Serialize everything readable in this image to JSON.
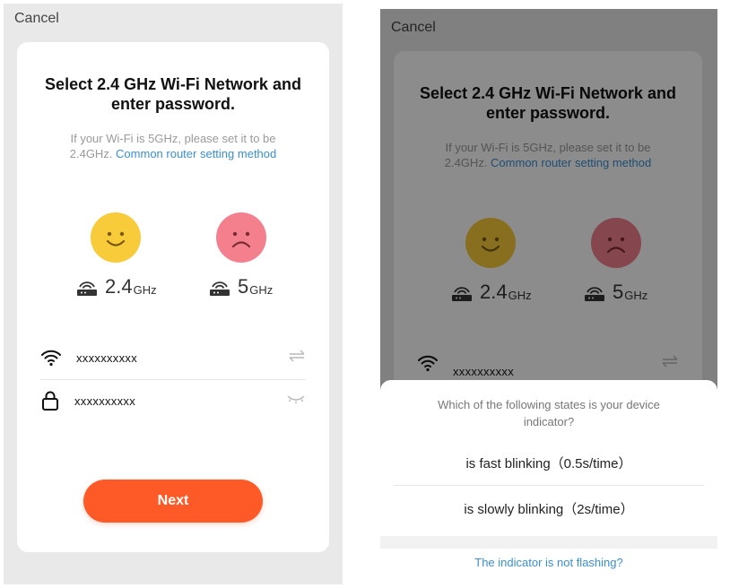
{
  "left_screen": {
    "cancel": "Cancel",
    "title_line1": "Select 2.4 GHz Wi-Fi Network and",
    "title_line2": "enter password.",
    "sub_line1": "If your Wi-Fi is 5GHz, please set it to be",
    "sub_line2_prefix": "2.4GHz. ",
    "sub_link": "Common router setting method",
    "band_24_value": "2.4",
    "band_24_unit": "GHz",
    "band_5_value": "5",
    "band_5_unit": "GHz",
    "wifi_value": "xxxxxxxxxx",
    "password_value": "xxxxxxxxxx",
    "next_label": "Next"
  },
  "right_screen": {
    "cancel": "Cancel",
    "title_line1": "Select 2.4 GHz Wi-Fi Network and",
    "title_line2": "enter password.",
    "sub_line1": "If your Wi-Fi is 5GHz, please set it to be",
    "sub_line2_prefix": "2.4GHz. ",
    "sub_link": "Common router setting method",
    "band_24_value": "2.4",
    "band_24_unit": "GHz",
    "band_5_value": "5",
    "band_5_unit": "GHz",
    "wifi_value": "xxxxxxxxxx",
    "sheet": {
      "question_line1": "Which of the following states is your device",
      "question_line2": "indicator?",
      "options": [
        "is fast blinking（0.5s/time）",
        "is slowly blinking（2s/time）"
      ],
      "not_flashing": "The indicator is not flashing?"
    }
  },
  "colors": {
    "accent": "#fe5a27",
    "link": "#3a8fd2",
    "happy_face": "#f7cb3a",
    "sad_face": "#f4808e"
  },
  "icons": [
    "smile-face-icon",
    "sad-face-icon",
    "router-icon",
    "wifi-icon",
    "lock-icon",
    "swap-icon",
    "eye-closed-icon"
  ]
}
